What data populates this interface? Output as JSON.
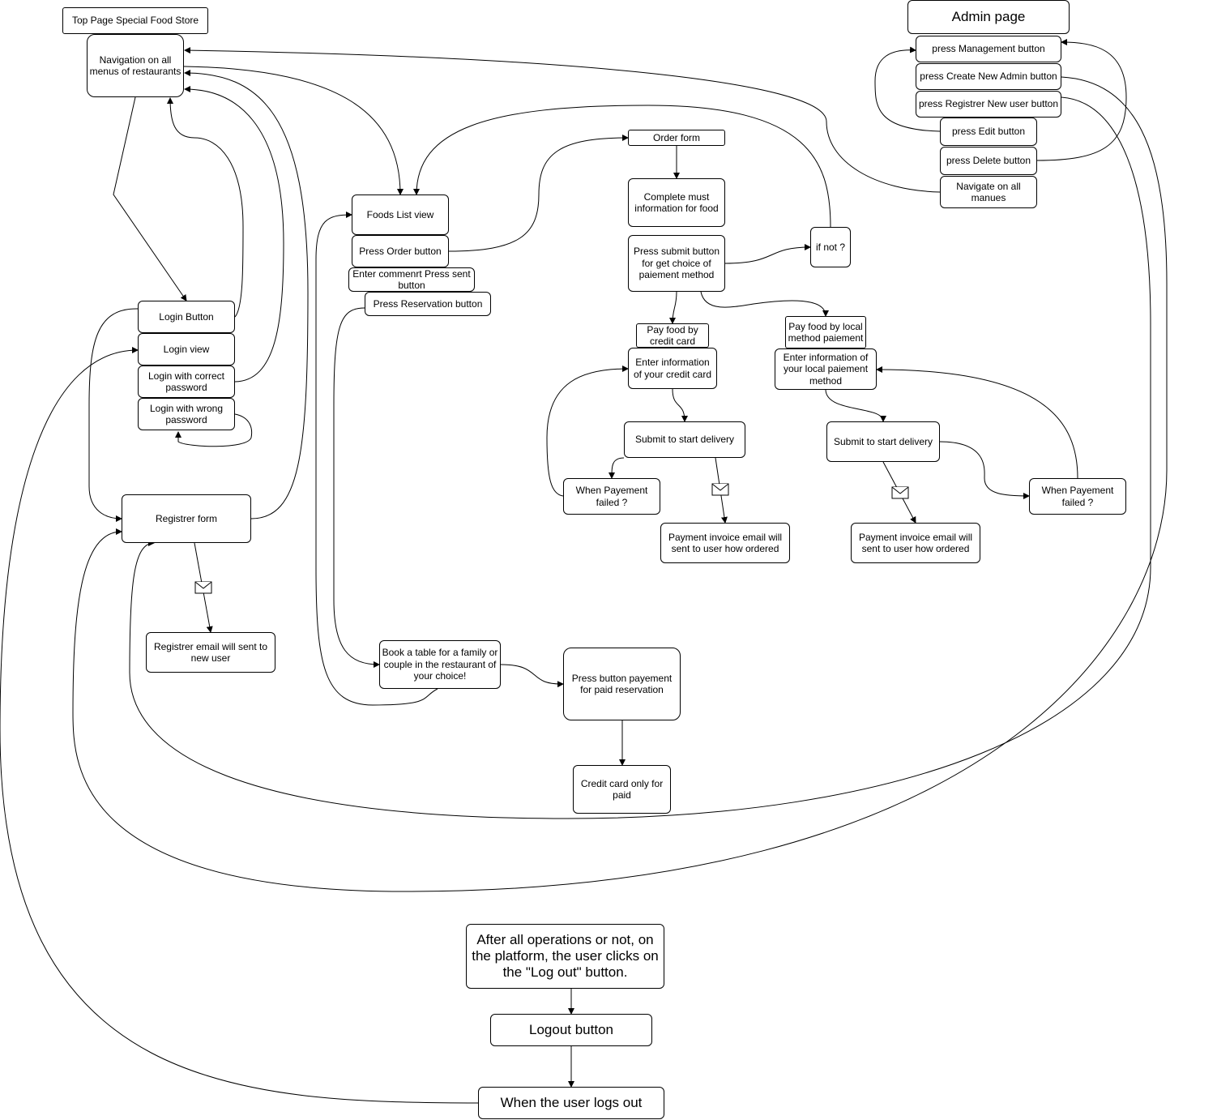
{
  "nodes": {
    "top_page": "Top Page Special Food Store",
    "nav_menus": "Navigation on all menus of restaurants",
    "admin_title": "Admin page",
    "press_mgmt": "press Management button",
    "press_create": "press Create New Admin button",
    "press_registrer": "press Registrer New user button",
    "press_edit": "press Edit button",
    "press_delete": "press Delete button",
    "navigate_all": "Navigate on all manues",
    "order_form": "Order form",
    "complete_info": "Complete must information for food",
    "press_submit": "Press submit button for get choice of paiement method",
    "if_not": "if not ?",
    "foods_list": "Foods List view",
    "press_order": "Press Order button",
    "enter_comment": "Enter commenrt Press sent button",
    "press_reservation": "Press Reservation button",
    "login_button": "Login Button",
    "login_view": "Login view",
    "login_correct": "Login with correct password",
    "login_wrong": "Login with wrong password",
    "pay_credit": "Pay food by credit card",
    "enter_credit": "Enter information of your credit card",
    "pay_local": "Pay food by local method paiement",
    "enter_local": "Enter information of your local paiement method",
    "submit_delivery1": "Submit to start delivery",
    "submit_delivery2": "Submit to start delivery",
    "payment_failed1": "When Payement failed ?",
    "payment_failed2": "When Payement failed ?",
    "invoice1": "Payment invoice email will sent to user how ordered",
    "invoice2": "Payment invoice email will sent to user how ordered",
    "registrer_form": "Registrer form",
    "registrer_email": "Registrer email will sent to new user",
    "book_table": "Book a table for a family or couple in the restaurant of your choice!",
    "press_pay_reservation": "Press button payement for paid reservation",
    "credit_only": "Credit card only for paid",
    "after_ops": "After all operations or not, on the platform, the user clicks on the \"Log out\" button.",
    "logout": "Logout button",
    "user_logs_out": "When the user logs out"
  },
  "icons": [
    "envelope-icon"
  ]
}
